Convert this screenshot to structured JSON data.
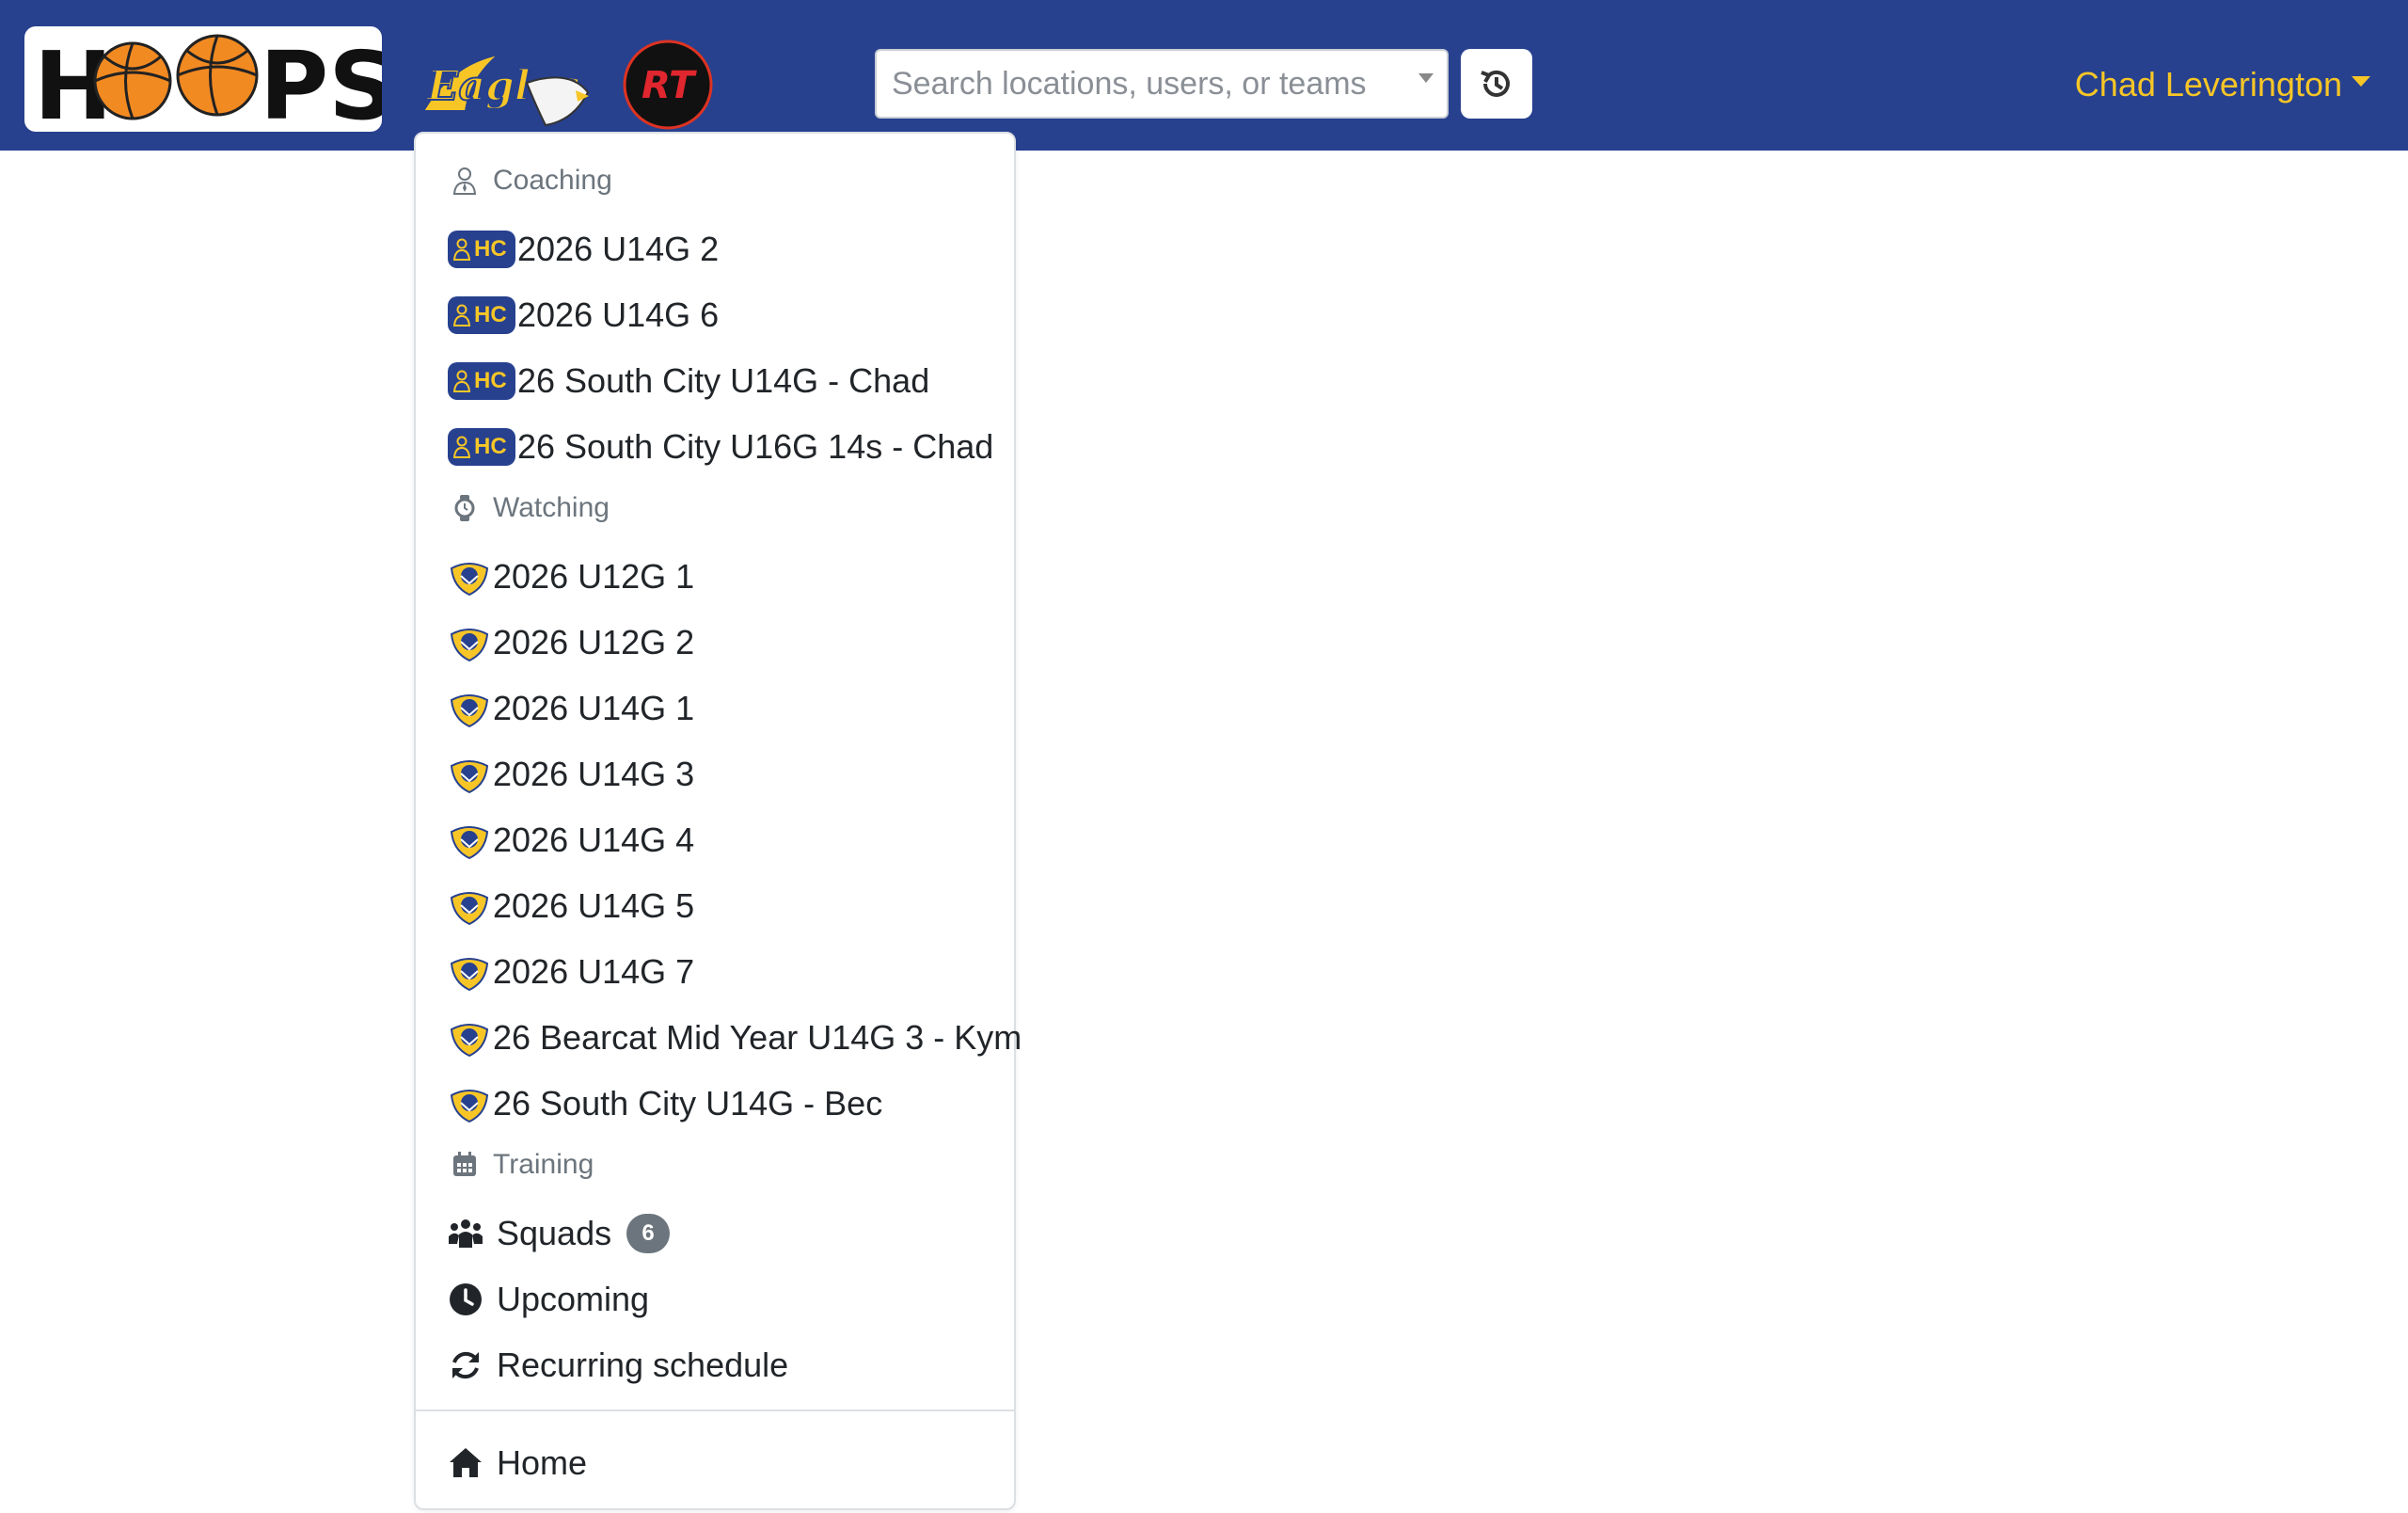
{
  "header": {
    "logo_text": "HOOPS",
    "search": {
      "placeholder": "Search locations, users, or teams"
    },
    "history_icon": "history-icon",
    "user_name": "Chad Leverington",
    "colors": {
      "navbar": "#27418f",
      "accent": "#f7c626"
    }
  },
  "menu": {
    "coaching": {
      "title": "Coaching",
      "icon": "user-tie-icon",
      "badge": "HC",
      "items": [
        "2026 U14G 2",
        "2026 U14G 6",
        "26 South City U14G - Chad",
        "26 South City U16G 14s - Chad"
      ]
    },
    "watching": {
      "title": "Watching",
      "icon": "watch-icon",
      "items": [
        "2026 U12G 1",
        "2026 U12G 2",
        "2026 U14G 1",
        "2026 U14G 3",
        "2026 U14G 4",
        "2026 U14G 5",
        "2026 U14G 7",
        "26 Bearcat Mid Year U14G 3 - Kym",
        "26 South City U14G - Bec"
      ]
    },
    "training": {
      "title": "Training",
      "icon": "calendar-icon",
      "squads": {
        "label": "Squads",
        "count": "6",
        "icon": "users-icon"
      },
      "upcoming": {
        "label": "Upcoming",
        "icon": "clock-icon"
      },
      "recurring": {
        "label": "Recurring schedule",
        "icon": "sync-icon"
      }
    },
    "home": {
      "label": "Home",
      "icon": "home-icon"
    }
  }
}
